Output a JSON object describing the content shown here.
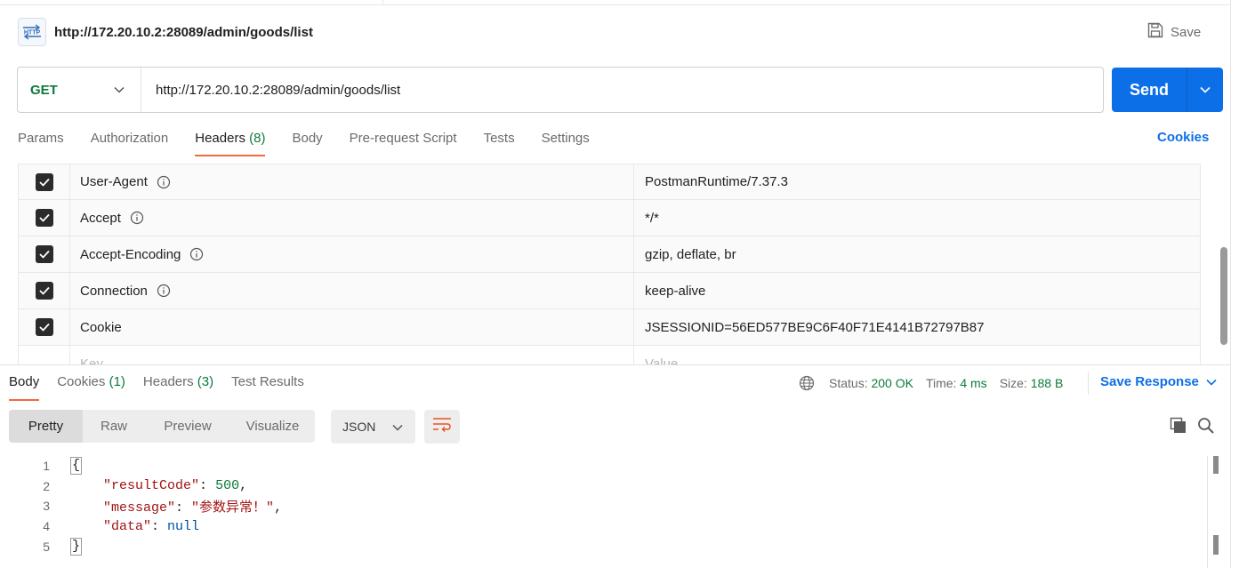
{
  "request": {
    "title": "http://172.20.10.2:28089/admin/goods/list",
    "icon_label": "HTTP",
    "save_label": "Save",
    "method": "GET",
    "url": "http://172.20.10.2:28089/admin/goods/list",
    "send_label": "Send"
  },
  "request_tabs": {
    "params": "Params",
    "authorization": "Authorization",
    "headers": "Headers",
    "headers_count": "(8)",
    "body": "Body",
    "prerequest": "Pre-request Script",
    "tests": "Tests",
    "settings": "Settings",
    "cookies": "Cookies"
  },
  "headers": [
    {
      "key": "User-Agent",
      "value": "PostmanRuntime/7.37.3",
      "checked": true,
      "info": true
    },
    {
      "key": "Accept",
      "value": "*/*",
      "checked": true,
      "info": true
    },
    {
      "key": "Accept-Encoding",
      "value": "gzip, deflate, br",
      "checked": true,
      "info": true
    },
    {
      "key": "Connection",
      "value": "keep-alive",
      "checked": true,
      "info": true
    },
    {
      "key": "Cookie",
      "value": "JSESSIONID=56ED577BE9C6F40F71E4141B72797B87",
      "checked": true,
      "info": false
    }
  ],
  "headers_placeholder": {
    "key": "Key",
    "value": "Value"
  },
  "response_tabs": {
    "body": "Body",
    "cookies": "Cookies",
    "cookies_count": "(1)",
    "headers": "Headers",
    "headers_count": "(3)",
    "test_results": "Test Results"
  },
  "response_status": {
    "status_label": "Status:",
    "status_value": "200 OK",
    "time_label": "Time:",
    "time_value": "4 ms",
    "size_label": "Size:",
    "size_value": "188 B",
    "save_response": "Save Response"
  },
  "view_modes": {
    "pretty": "Pretty",
    "raw": "Raw",
    "preview": "Preview",
    "visualize": "Visualize",
    "format": "JSON"
  },
  "code": {
    "line_numbers": [
      "1",
      "2",
      "3",
      "4",
      "5"
    ],
    "open_brace": "{",
    "close_brace": "}",
    "key1": "\"resultCode\"",
    "val1": "500",
    "key2": "\"message\"",
    "val2": "\"参数异常！\"",
    "key3": "\"data\"",
    "val3": "null"
  },
  "colors": {
    "accent": "#0d6fe8",
    "tab_underline": "#f26b3a",
    "success_green": "#0b7a3b"
  }
}
